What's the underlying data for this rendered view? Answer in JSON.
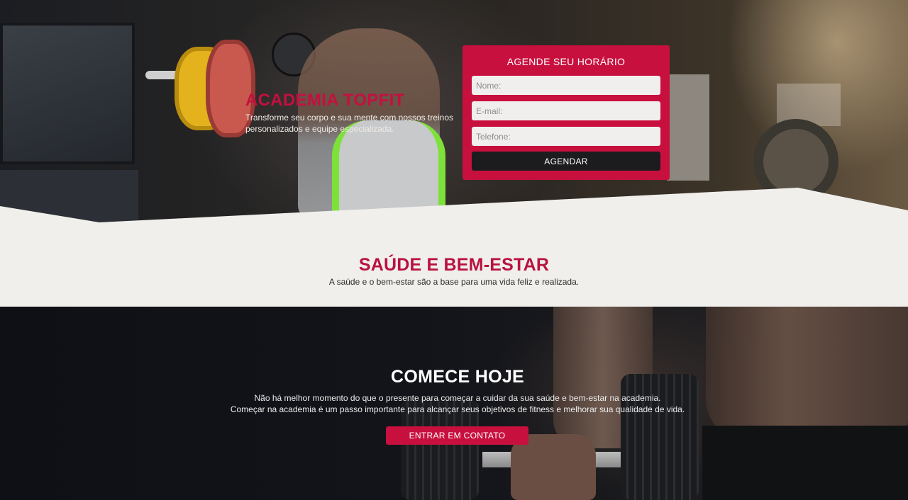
{
  "hero": {
    "title": "ACADEMIA TOPFIT",
    "subtitle": "Transforme seu corpo e sua mente com nossos treinos personalizados e equipe especializada."
  },
  "form": {
    "title": "AGENDE SEU HORÁRIO",
    "name_placeholder": "Nome:",
    "email_placeholder": "E-mail:",
    "phone_placeholder": "Telefone:",
    "submit_label": "AGENDAR"
  },
  "wellness": {
    "title": "SAÚDE E BEM-ESTAR",
    "subtitle": "A saúde e o bem-estar são a base para uma vida feliz e realizada."
  },
  "cta": {
    "title": "COMECE HOJE",
    "line1": "Não há melhor momento do que o presente para começar a cuidar da sua saúde e bem-estar na academia.",
    "line2": "Começar na academia é um passo importante para alcançar seus objetivos de fitness e melhorar sua qualidade de vida.",
    "button_label": "ENTRAR EM CONTATO"
  },
  "colors": {
    "accent": "#c8103e",
    "dark_button": "#1c1c1e",
    "section_light": "#f0efeb"
  }
}
